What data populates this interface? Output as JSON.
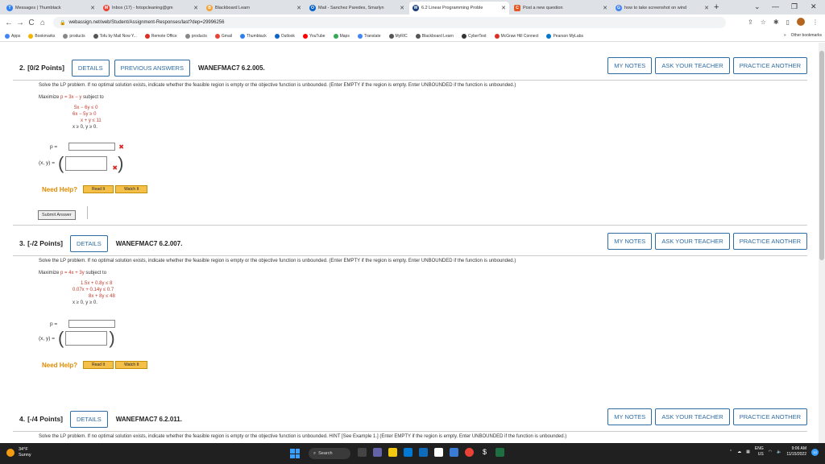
{
  "browser": {
    "tabs": [
      {
        "label": "Messages | Thumbtack",
        "color": "#2f80ed",
        "glyph": "T"
      },
      {
        "label": "Inbox (17) - fotopcleaning@gm",
        "color": "#ea4335",
        "glyph": "M"
      },
      {
        "label": "Blackboard Learn",
        "color": "#f2a33a",
        "glyph": "B"
      },
      {
        "label": "Mail - Sanchez Paredes, Smarlyn",
        "color": "#0a64c8",
        "glyph": "O"
      },
      {
        "label": "6.2 Linear Programming Proble",
        "color": "#1a3f7a",
        "glyph": "W"
      },
      {
        "label": "Post a new question",
        "color": "#e25822",
        "glyph": "C"
      },
      {
        "label": "how to take screenshot on wind",
        "color": "#4285f4",
        "glyph": "G"
      }
    ],
    "active_tab_index": 4,
    "new_tab": "+",
    "url": "webassign.net/web/Student/Assignment-Responses/last?dep=29996256",
    "nav": {
      "back": "←",
      "forward": "→",
      "reload": "C",
      "home": "⌂"
    },
    "bookmarks": [
      {
        "label": "Apps",
        "color": "#4285f4"
      },
      {
        "label": "Bookmarks",
        "color": "#f4b400"
      },
      {
        "label": "products",
        "color": "#888888"
      },
      {
        "label": "Tofu by Mail Now Y...",
        "color": "#555555"
      },
      {
        "label": "Remote Office",
        "color": "#d93025"
      },
      {
        "label": "products",
        "color": "#888888"
      },
      {
        "label": "Gmail",
        "color": "#ea4335"
      },
      {
        "label": "Thumbtack",
        "color": "#2f80ed"
      },
      {
        "label": "Outlook",
        "color": "#0a64c8"
      },
      {
        "label": "YouTube",
        "color": "#ff0000"
      },
      {
        "label": "Maps",
        "color": "#34a853"
      },
      {
        "label": "Translate",
        "color": "#4285f4"
      },
      {
        "label": "MyRIC",
        "color": "#555555"
      },
      {
        "label": "Blackboard Learn",
        "color": "#555555"
      },
      {
        "label": "CyberText",
        "color": "#333333"
      },
      {
        "label": "McGraw Hill Connect",
        "color": "#d93025"
      },
      {
        "label": "Pearson MyLabs",
        "color": "#0077c8"
      }
    ],
    "bookmarks_more": "»",
    "other_bookmarks": "Other bookmarks"
  },
  "questions": [
    {
      "number": "2.",
      "points": "[0/2 Points]",
      "details": "DETAILS",
      "previous": "PREVIOUS ANSWERS",
      "id": "WANEFMAC7 6.2.005.",
      "my_notes": "MY NOTES",
      "ask_teacher": "ASK YOUR TEACHER",
      "practice": "PRACTICE ANOTHER",
      "prompt": "Solve the LP problem. If no optimal solution exists, indicate whether the feasible region is empty or the objective function is unbounded. (Enter EMPTY if the region is empty. Enter UNBOUNDED if the function is unbounded.)",
      "maximize_label": "Maximize",
      "objective": "p = 3x − y",
      "subject_to": "subject to",
      "constraints": [
        "5x − 6y ≤ 0",
        "6x − 5y ≥ 0",
        "x + y ≤ 11"
      ],
      "nonneg": "x ≥ 0, y ≥ 0.",
      "p_label": "p =",
      "xy_label": "(x, y) =",
      "wrong_mark": "✖",
      "need_help": "Need Help?",
      "read_it": "Read It",
      "watch_it": "Watch It",
      "submit": "Submit Answer"
    },
    {
      "number": "3.",
      "points": "[-/2 Points]",
      "details": "DETAILS",
      "id": "WANEFMAC7 6.2.007.",
      "my_notes": "MY NOTES",
      "ask_teacher": "ASK YOUR TEACHER",
      "practice": "PRACTICE ANOTHER",
      "prompt": "Solve the LP problem. If no optimal solution exists, indicate whether the feasible region is empty or the objective function is unbounded. (Enter EMPTY if the region is empty. Enter UNBOUNDED if the function is unbounded.)",
      "maximize_label": "Maximize",
      "objective": "p = 4x + 3y",
      "subject_to": "subject to",
      "constraints": [
        "1.5x + 0.8y ≤ 8",
        "0.07x + 0.14y ≤ 0.7",
        "8x + 8y ≤ 48"
      ],
      "nonneg": "x ≥ 0, y ≥ 0.",
      "p_label": "p =",
      "xy_label": "(x, y) =",
      "need_help": "Need Help?",
      "read_it": "Read It",
      "watch_it": "Watch It"
    },
    {
      "number": "4.",
      "points": "[-/4 Points]",
      "details": "DETAILS",
      "id": "WANEFMAC7 6.2.011.",
      "my_notes": "MY NOTES",
      "ask_teacher": "ASK YOUR TEACHER",
      "practice": "PRACTICE ANOTHER",
      "prompt": "Solve the LP problem. If no optimal solution exists, indicate whether the feasible region is empty or the objective function is unbounded. HINT [See Example 1.] (Enter EMPTY if the region is empty. Enter UNBOUNDED if the function is unbounded.)"
    }
  ],
  "taskbar": {
    "temperature": "34°F",
    "condition": "Sunny",
    "search": "Search",
    "language": "ENG",
    "region": "US",
    "time": "9:06 AM",
    "date": "11/15/2022",
    "notifications": "10"
  }
}
